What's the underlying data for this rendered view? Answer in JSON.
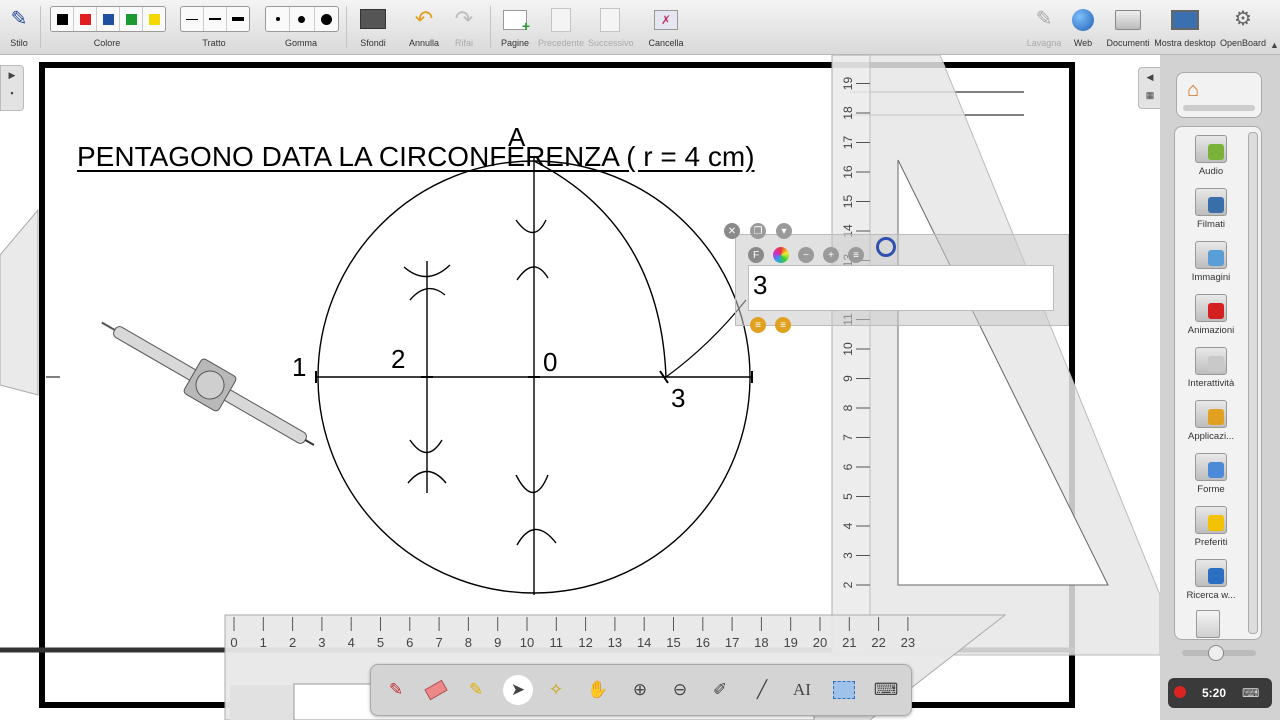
{
  "toolbar": {
    "stile": "Stilo",
    "colore": "Colore",
    "tratto": "Tratto",
    "gomma": "Gomma",
    "sfondi": "Sfondi",
    "annulla": "Annulla",
    "rifai": "Rifai",
    "pagine": "Pagine",
    "precedente": "Precedente",
    "successivo": "Successivo",
    "cancella": "Cancella",
    "lavagna": "Lavagna",
    "web": "Web",
    "documenti": "Documenti",
    "mostra_desktop": "Mostra desktop",
    "openboard": "OpenBoard",
    "colors": [
      "#000000",
      "#e02020",
      "#1f4fa0",
      "#1a9a30",
      "#f5d800"
    ]
  },
  "board": {
    "title": "PENTAGONO DATA LA CIRCONFERENZA ( r = 4 cm)",
    "labels": {
      "a": "A",
      "one": "1",
      "two": "2",
      "zero": "0",
      "three": "3"
    },
    "textbox_value": "3",
    "ruler_ticks": [
      "0",
      "1",
      "2",
      "3",
      "4",
      "5",
      "6",
      "7",
      "8",
      "9",
      "10",
      "11",
      "12",
      "13",
      "14",
      "15",
      "16",
      "17",
      "18",
      "19",
      "20",
      "21",
      "22",
      "23"
    ],
    "vruler_ticks": [
      "2",
      "3",
      "4",
      "5",
      "6",
      "7",
      "8",
      "9",
      "10",
      "11",
      "12",
      "13",
      "14",
      "15",
      "16",
      "17",
      "18",
      "19"
    ],
    "protractor_ticks": [
      "22",
      "23"
    ]
  },
  "library": {
    "items": [
      {
        "label": "Audio",
        "color": "#7bb33a"
      },
      {
        "label": "Filmati",
        "color": "#3a6ea8"
      },
      {
        "label": "Immagini",
        "color": "#5a9ed8"
      },
      {
        "label": "Animazioni",
        "color": "#d42020"
      },
      {
        "label": "Interattività",
        "color": "#c9c9c9"
      },
      {
        "label": "Applicazi...",
        "color": "#e0a020"
      },
      {
        "label": "Forme",
        "color": "#4a8ad8"
      },
      {
        "label": "Preferiti",
        "color": "#f2c200"
      },
      {
        "label": "Ricerca w...",
        "color": "#2a6fc2"
      }
    ]
  },
  "status": {
    "time": "5:20"
  }
}
